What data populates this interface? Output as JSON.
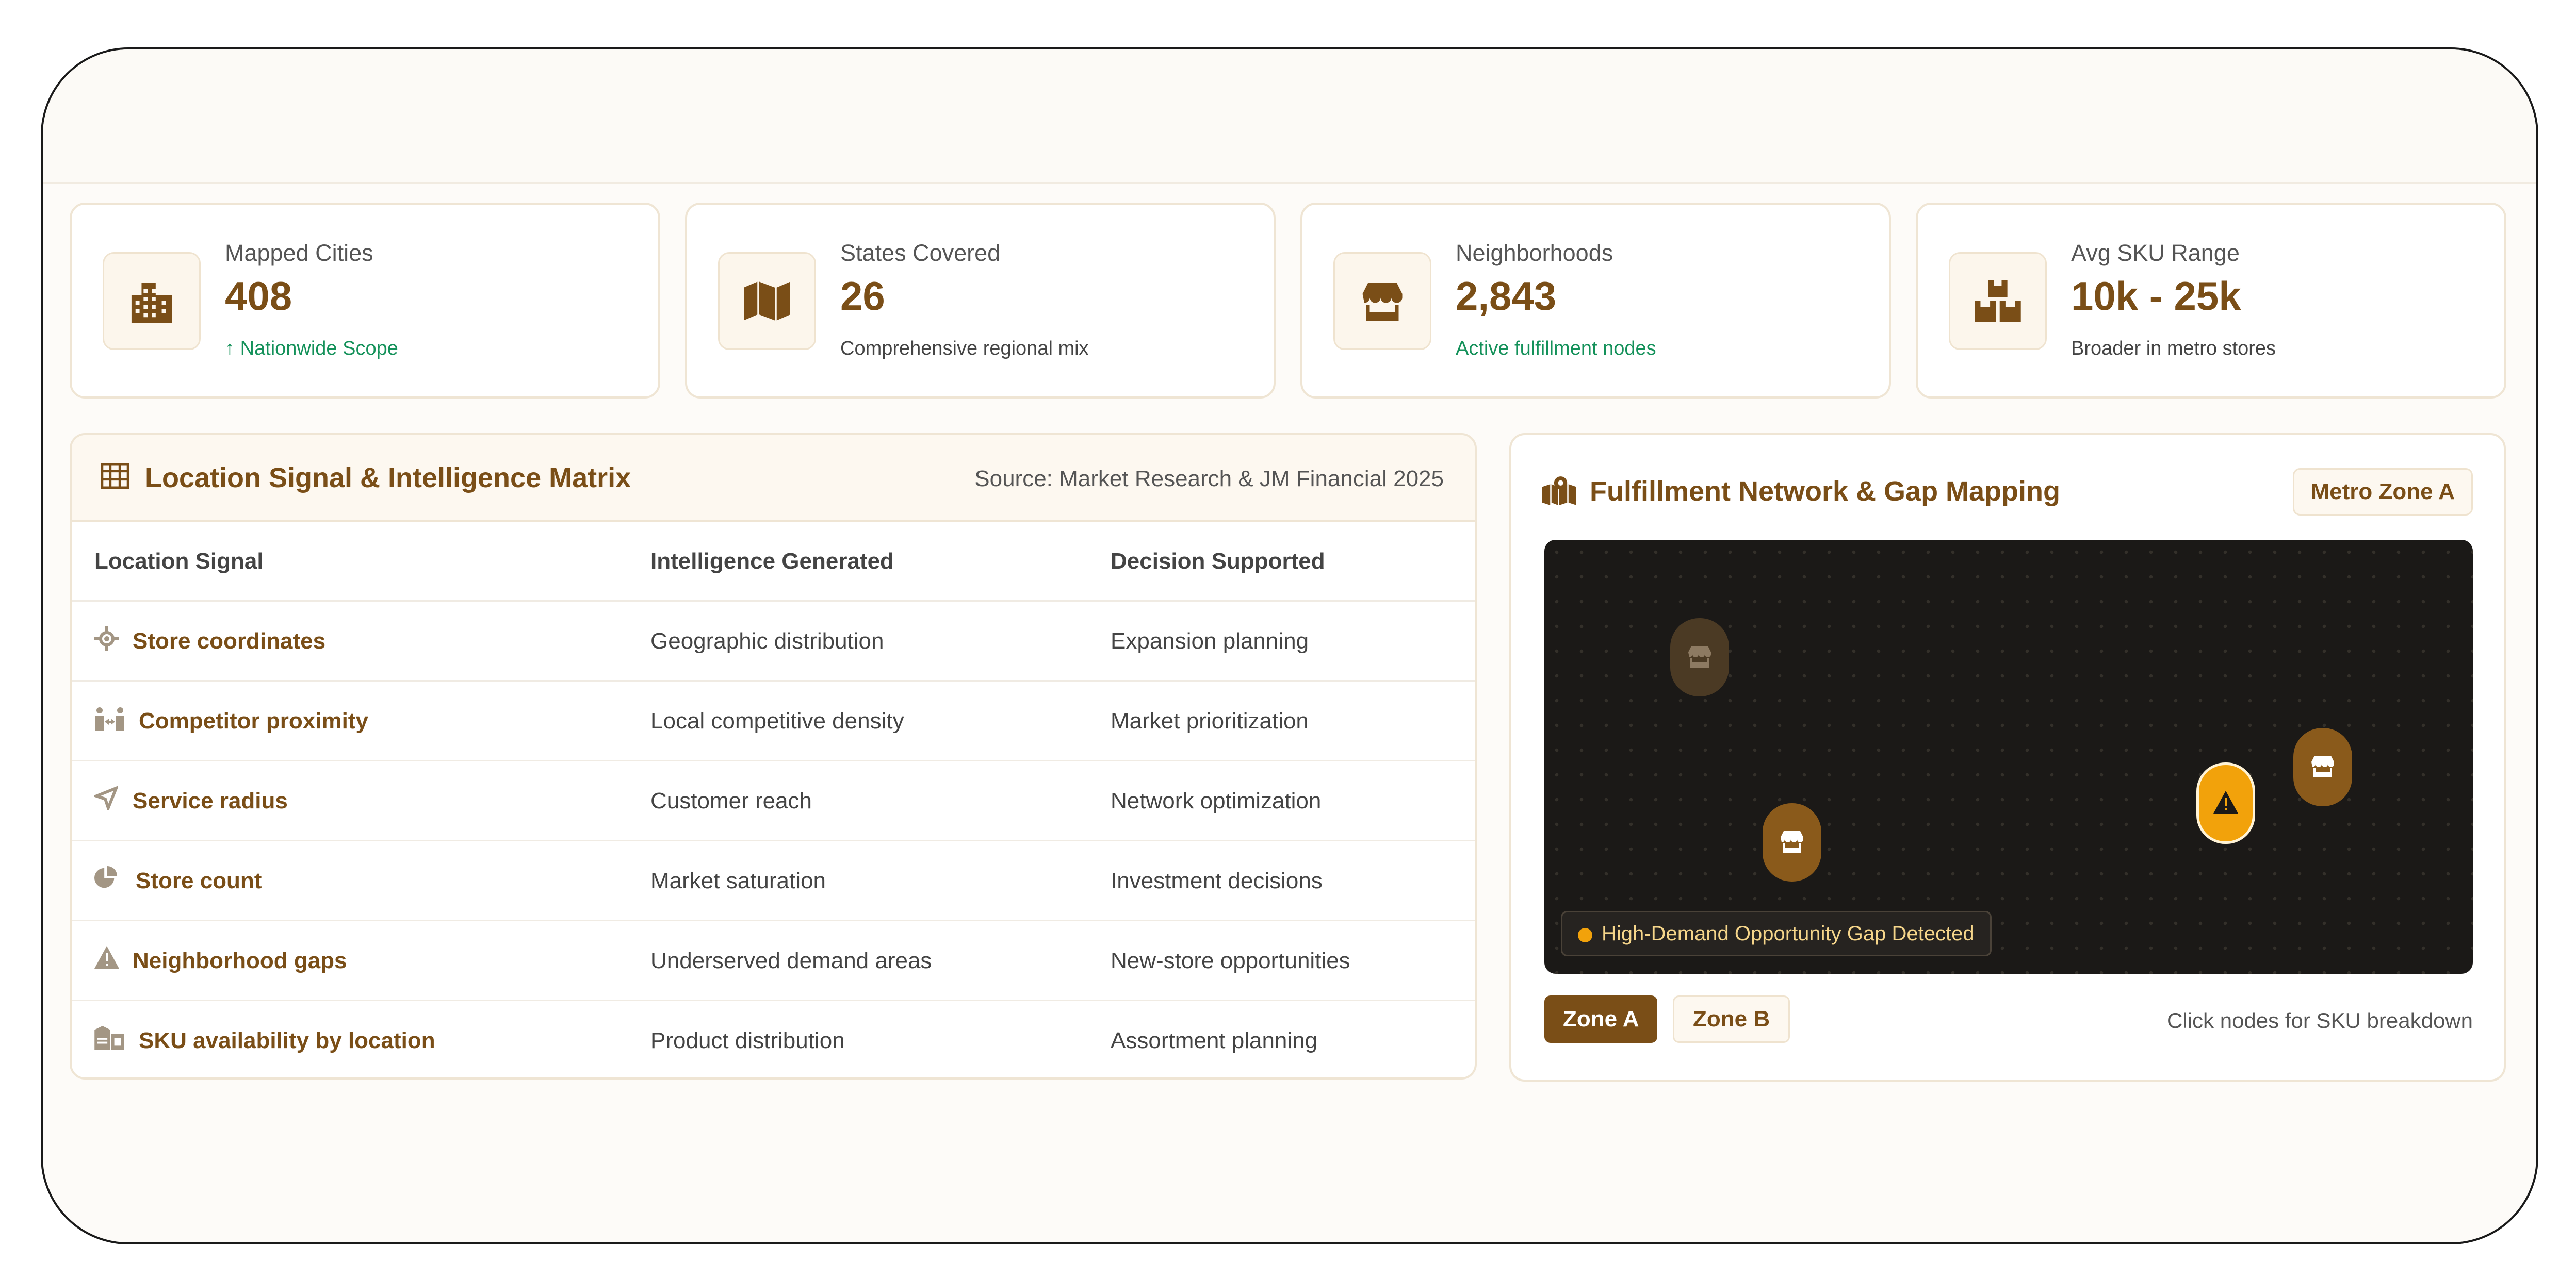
{
  "stats": [
    {
      "label": "Mapped Cities",
      "value": "408",
      "note": "Nationwide Scope",
      "icon": "city-icon"
    },
    {
      "label": "States Covered",
      "value": "26",
      "note": "Comprehensive regional mix",
      "icon": "map-icon"
    },
    {
      "label": "Neighborhoods",
      "value": "2,843",
      "note": "Active fulfillment nodes",
      "icon": "store-icon"
    },
    {
      "label": "Avg SKU Range",
      "value": "10k - 25k",
      "note": "Broader in metro stores",
      "icon": "boxes-icon"
    }
  ],
  "matrix": {
    "title": "Location Signal & Intelligence Matrix",
    "source": "Source: Market Research & JM Financial 2025",
    "headers": [
      "Location Signal",
      "Intelligence Generated",
      "Decision Supported"
    ],
    "rows": [
      {
        "signal": "Store coordinates",
        "intel": "Geographic distribution",
        "decision": "Expansion planning",
        "icon": "crosshair-icon"
      },
      {
        "signal": "Competitor proximity",
        "intel": "Local competitive density",
        "decision": "Market prioritization",
        "icon": "people-arrows-icon"
      },
      {
        "signal": "Service radius",
        "intel": "Customer reach",
        "decision": "Network optimization",
        "icon": "location-arrow-icon"
      },
      {
        "signal": "Store count",
        "intel": "Market saturation",
        "decision": "Investment decisions",
        "icon": "pie-chart-icon"
      },
      {
        "signal": "Neighborhood gaps",
        "intel": "Underserved demand areas",
        "decision": "New-store opportunities",
        "icon": "warning-icon"
      },
      {
        "signal": "SKU availability by location",
        "intel": "Product distribution",
        "decision": "Assortment planning",
        "icon": "warehouse-icon"
      }
    ]
  },
  "network": {
    "title": "Fulfillment Network & Gap Mapping",
    "zone_badge": "Metro Zone A",
    "alert": "High-Demand Opportunity Gap Detected",
    "zones": [
      "Zone A",
      "Zone B"
    ],
    "hint": "Click nodes for SKU breakdown"
  },
  "colors": {
    "accent": "#7a4e17",
    "positive": "#14915a",
    "alert": "#f2a20b",
    "map_bg": "#1b1917"
  }
}
